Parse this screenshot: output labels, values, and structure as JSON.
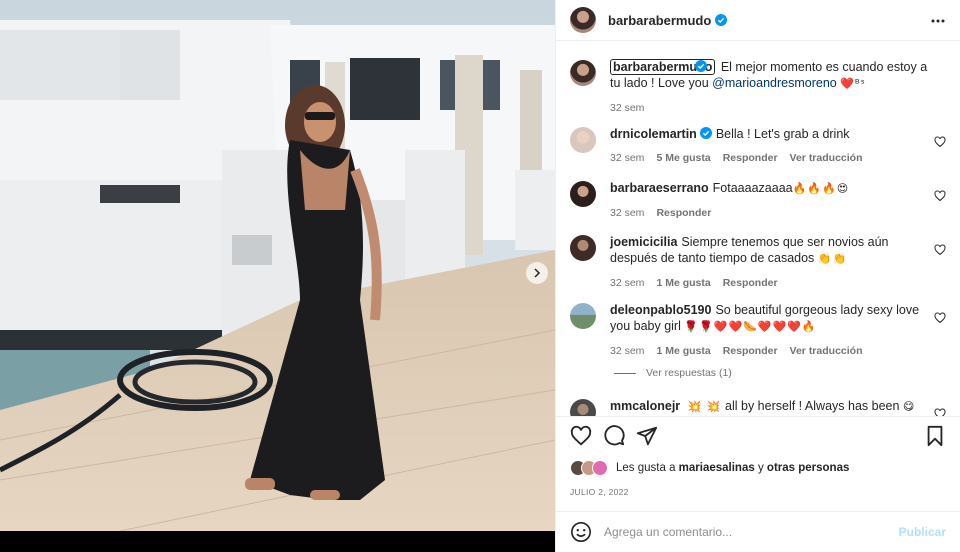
{
  "post": {
    "author": "barbarabermudo",
    "caption_text": "El mejor momento es cuando estoy a tu lado ! Love you",
    "caption_mention": "@marioandresmoreno",
    "caption_emoji": "❤️ᴮˢ",
    "caption_time": "32 sem"
  },
  "comments": [
    {
      "user": "drnicolemartin",
      "verified": true,
      "text": "Bella ! Let's grab a drink",
      "time": "32 sem",
      "likes": "5 Me gusta",
      "reply": "Responder",
      "translate": "Ver traducción"
    },
    {
      "user": "barbaraeserrano",
      "text": "Fotaaaazaaaa",
      "emoji": "🔥🔥🔥😍",
      "time": "32 sem",
      "reply": "Responder"
    },
    {
      "user": "joemicicilia",
      "text": "Siempre tenemos que ser novios aún después de tanto tiempo de casados",
      "emoji": "👏👏",
      "time": "32 sem",
      "likes": "1 Me gusta",
      "reply": "Responder"
    },
    {
      "user": "deleonpablo5190",
      "text": "So beautiful gorgeous lady sexy love you baby girl",
      "emoji": "🌹🌹❤️❤️🌭❤️❤️❤️🔥",
      "time": "32 sem",
      "likes": "1 Me gusta",
      "reply": "Responder",
      "translate": "Ver traducción",
      "view_replies": "Ver respuestas (1)"
    },
    {
      "user": "mmcalonejr",
      "text": "all by herself ! Always has been",
      "emoji_before": "💥 💥",
      "emoji_after": "😋"
    }
  ],
  "likes_line": {
    "prefix": "Les gusta a",
    "user": "mariaesalinas",
    "middle": "y",
    "others": "otras personas"
  },
  "date": "JULIO 2, 2022",
  "add_comment": {
    "placeholder": "Agrega un comentario...",
    "publish_label": "Publicar"
  },
  "colors": {
    "verified_blue": "#0095f6",
    "publish_disabled": "#b2dffc",
    "mention_link": "#00376b",
    "muted_text": "#737373"
  },
  "icons": [
    "more-options-icon",
    "verified-badge-icon",
    "heart-icon",
    "comment-icon",
    "share-icon",
    "bookmark-icon",
    "emoji-icon",
    "carousel-next-icon"
  ]
}
